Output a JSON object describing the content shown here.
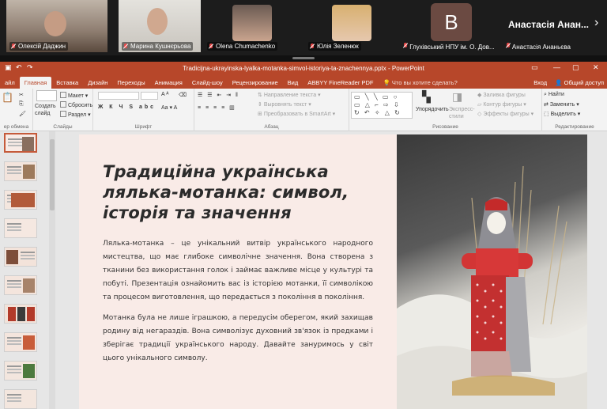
{
  "meeting": {
    "participants": [
      {
        "name": "Олексій Даджин"
      },
      {
        "name": "Марина Кушнєрьова"
      },
      {
        "name": "Olena Chumachenko"
      },
      {
        "name": "Юлія Зеленюк"
      }
    ],
    "avatar_letter": "B",
    "featured_name": "Анастасія Анан...",
    "bottom_names": [
      "Глухівський НПУ ім. О. Дов...",
      "Анастасія Ананьєва"
    ]
  },
  "window": {
    "title": "Tradicijna-ukrayinska-lyalka-motanka-simvol-istoriya-ta-znachennya.pptx - PowerPoint"
  },
  "ribbon_tabs": [
    "айл",
    "Главная",
    "Вставка",
    "Дизайн",
    "Переходы",
    "Анимация",
    "Слайд-шоу",
    "Рецензирование",
    "Вид",
    "ABBYY FineReader PDF"
  ],
  "tell_me": "Что вы хотите сделать?",
  "tabs_right": {
    "signin": "Вход",
    "share": "Общий доступ"
  },
  "ribbon": {
    "clipboard_label": "ер обмена",
    "slides": {
      "new_slide": "Создать слайд",
      "layout": "Макет",
      "reset": "Сбросить",
      "section": "Раздел",
      "label": "Слайды"
    },
    "font": {
      "label": "Шрифт"
    },
    "paragraph": {
      "text_direction": "Направление текста",
      "align_text": "Выровнять текст",
      "smartart": "Преобразовать в SmartArt",
      "label": "Абзац"
    },
    "drawing": {
      "arrange": "Упорядочить",
      "quick_styles": "Экспресс-стили",
      "fill": "Заливка фигуры",
      "outline": "Контур фигуры",
      "effects": "Эффекты фигуры",
      "label": "Рисование",
      "shapes_glyphs": "▭ ╲ ╲ ▭ ○ ▭ △ ⌐ ⇨ ⇩ ↻ ↶ ✧ △ ↻ ⌐ { } ★"
    },
    "editing": {
      "find": "Найти",
      "replace": "Заменить",
      "select": "Выделить",
      "label": "Редактирование"
    }
  },
  "slide": {
    "title": "Традиційна українська лялька-мотанка: символ, історія та значення",
    "para1": "Лялька-мотанка – це унікальний витвір українського народного мистецтва, що має глибоке символічне значення. Вона створена з тканини без використання голок і займає важливе місце у культурі та побуті. Презентація ознайомить вас із історією мотанки, її символікою та процесом виготовлення, що передається з покоління в покоління.",
    "para2": "Мотанка була не лише іграшкою, а передусім оберегом, який захищав родину від негараздів. Вона символізує духовний зв'язок із предками і зберігає традиції українського народу. Давайте зануримось у світ цього унікального символу."
  },
  "thumbnails": {
    "numbers": [
      "",
      "",
      "",
      "",
      "",
      "",
      "",
      "",
      "",
      ""
    ]
  },
  "colors": {
    "accent": "#b7472a",
    "slide_bg": "#f9ebe7"
  }
}
